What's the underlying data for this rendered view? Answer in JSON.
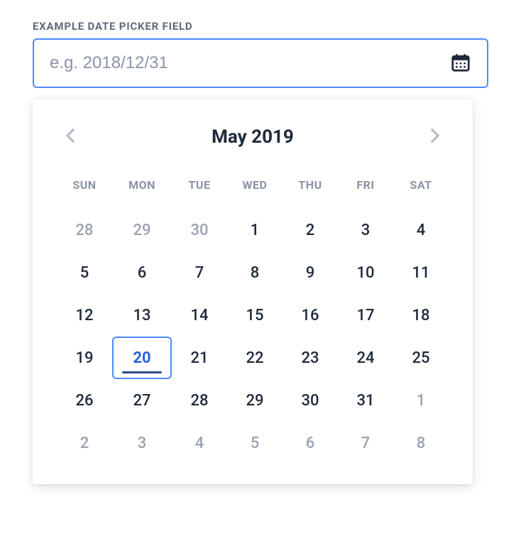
{
  "field": {
    "label": "EXAMPLE DATE PICKER FIELD",
    "placeholder": "e.g. 2018/12/31",
    "value": ""
  },
  "calendar": {
    "month_label": "May 2019",
    "dow": [
      "SUN",
      "MON",
      "TUE",
      "WED",
      "THU",
      "FRI",
      "SAT"
    ],
    "days": [
      {
        "n": "28",
        "outside": true
      },
      {
        "n": "29",
        "outside": true
      },
      {
        "n": "30",
        "outside": true
      },
      {
        "n": "1"
      },
      {
        "n": "2"
      },
      {
        "n": "3"
      },
      {
        "n": "4"
      },
      {
        "n": "5"
      },
      {
        "n": "6"
      },
      {
        "n": "7"
      },
      {
        "n": "8"
      },
      {
        "n": "9"
      },
      {
        "n": "10"
      },
      {
        "n": "11"
      },
      {
        "n": "12"
      },
      {
        "n": "13"
      },
      {
        "n": "14"
      },
      {
        "n": "15"
      },
      {
        "n": "16"
      },
      {
        "n": "17"
      },
      {
        "n": "18"
      },
      {
        "n": "19"
      },
      {
        "n": "20",
        "today": true
      },
      {
        "n": "21"
      },
      {
        "n": "22"
      },
      {
        "n": "23"
      },
      {
        "n": "24"
      },
      {
        "n": "25"
      },
      {
        "n": "26"
      },
      {
        "n": "27"
      },
      {
        "n": "28"
      },
      {
        "n": "29"
      },
      {
        "n": "30"
      },
      {
        "n": "31"
      },
      {
        "n": "1",
        "outside": true
      },
      {
        "n": "2",
        "outside": true
      },
      {
        "n": "3",
        "outside": true
      },
      {
        "n": "4",
        "outside": true
      },
      {
        "n": "5",
        "outside": true
      },
      {
        "n": "6",
        "outside": true
      },
      {
        "n": "7",
        "outside": true
      },
      {
        "n": "8",
        "outside": true
      }
    ]
  }
}
